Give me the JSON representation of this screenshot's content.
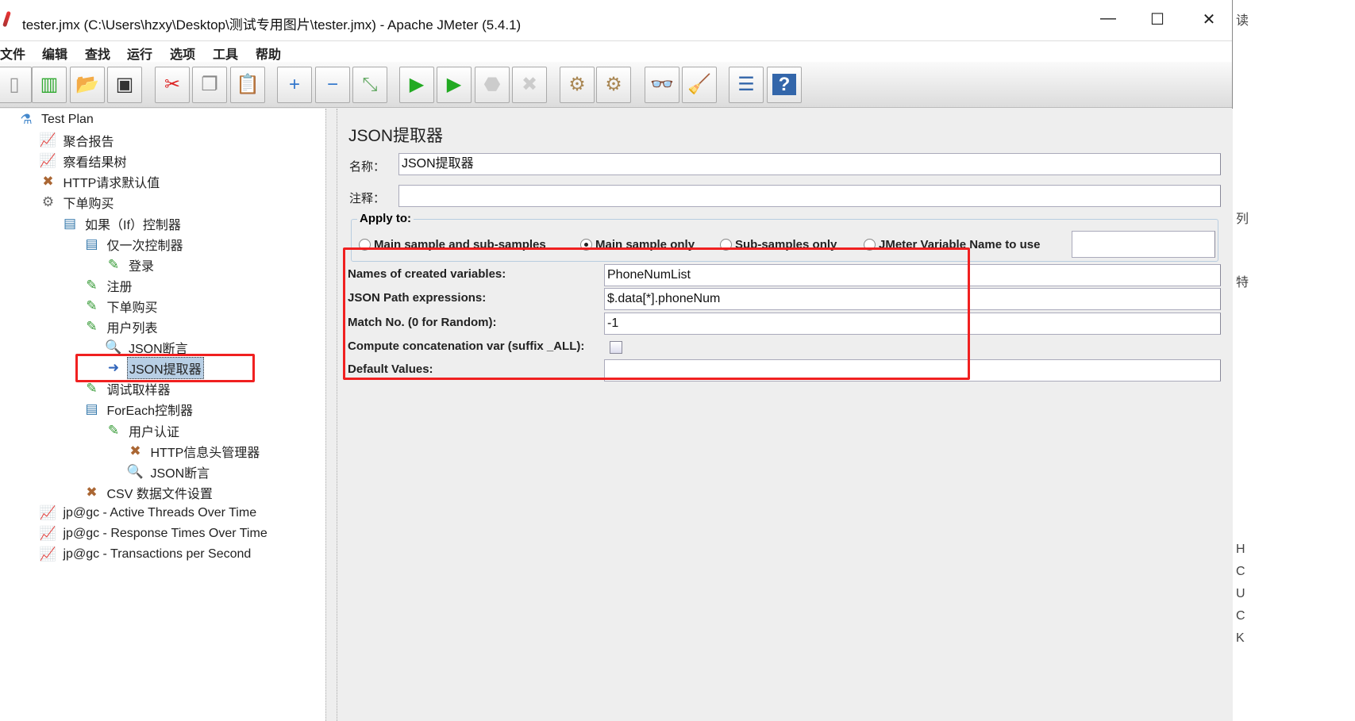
{
  "window": {
    "title": "tester.jmx (C:\\Users\\hzxy\\Desktop\\测试专用图片\\tester.jmx) - Apache JMeter (5.4.1)",
    "minimize": "—",
    "maximize": "☐",
    "close": "✕"
  },
  "menu": [
    "文件",
    "编辑",
    "查找",
    "运行",
    "选项",
    "工具",
    "帮助"
  ],
  "toolbar": [
    {
      "icon": "new-icon",
      "glyph": "▯",
      "color": "#999"
    },
    {
      "icon": "templates-icon",
      "glyph": "▥",
      "color": "#3a3"
    },
    {
      "icon": "open-icon",
      "glyph": "📂",
      "color": "#d90"
    },
    {
      "icon": "save-icon",
      "glyph": "▣",
      "color": "#333"
    },
    {
      "icon": "cut-icon",
      "glyph": "✂",
      "color": "#d22"
    },
    {
      "icon": "copy-icon",
      "glyph": "❐",
      "color": "#888"
    },
    {
      "icon": "paste-icon",
      "glyph": "📋",
      "color": "#a70"
    },
    {
      "icon": "expand-icon",
      "glyph": "+",
      "color": "#37c"
    },
    {
      "icon": "collapse-icon",
      "glyph": "−",
      "color": "#37c"
    },
    {
      "icon": "toggle-icon",
      "glyph": "⤡",
      "color": "#6a6"
    },
    {
      "icon": "start-icon",
      "glyph": "▶",
      "color": "#2a2"
    },
    {
      "icon": "start-no-pauses-icon",
      "glyph": "▶",
      "color": "#2a2"
    },
    {
      "icon": "stop-icon",
      "glyph": "⬣",
      "color": "#ccc"
    },
    {
      "icon": "shutdown-icon",
      "glyph": "✖",
      "color": "#ccc"
    },
    {
      "icon": "clear-icon",
      "glyph": "⚙",
      "color": "#a85"
    },
    {
      "icon": "clear-all-icon",
      "glyph": "⚙",
      "color": "#a85"
    },
    {
      "icon": "search-icon",
      "glyph": "👓",
      "color": "#222"
    },
    {
      "icon": "reset-search-icon",
      "glyph": "🧹",
      "color": "#db0"
    },
    {
      "icon": "function-helper-icon",
      "glyph": "☰",
      "color": "#36a"
    },
    {
      "icon": "help-icon",
      "glyph": "?",
      "color": "#fff"
    }
  ],
  "tree": [
    {
      "label": "Test Plan",
      "level": 0,
      "icon": "test-plan-icon",
      "glyph": "⚗"
    },
    {
      "label": "聚合报告",
      "level": 1,
      "icon": "listener-icon",
      "glyph": "📈"
    },
    {
      "label": "察看结果树",
      "level": 1,
      "icon": "listener-icon",
      "glyph": "📈"
    },
    {
      "label": "HTTP请求默认值",
      "level": 1,
      "icon": "config-icon",
      "glyph": "✖"
    },
    {
      "label": "下单购买",
      "level": 1,
      "icon": "thread-group-icon",
      "glyph": "⚙"
    },
    {
      "label": "如果（If）控制器",
      "level": 2,
      "icon": "controller-icon",
      "glyph": "▤"
    },
    {
      "label": "仅一次控制器",
      "level": 3,
      "icon": "controller-icon",
      "glyph": "▤"
    },
    {
      "label": "登录",
      "level": 4,
      "icon": "sampler-icon",
      "glyph": "✎"
    },
    {
      "label": "注册",
      "level": 3,
      "icon": "sampler-icon",
      "glyph": "✎"
    },
    {
      "label": "下单购买",
      "level": 3,
      "icon": "sampler-icon",
      "glyph": "✎"
    },
    {
      "label": "用户列表",
      "level": 3,
      "icon": "sampler-icon",
      "glyph": "✎"
    },
    {
      "label": "JSON断言",
      "level": 4,
      "icon": "assertion-icon",
      "glyph": "🔍"
    },
    {
      "label": "JSON提取器",
      "level": 4,
      "icon": "extractor-icon",
      "glyph": "➜",
      "selected": true
    },
    {
      "label": "调试取样器",
      "level": 3,
      "icon": "sampler-icon",
      "glyph": "✎"
    },
    {
      "label": "ForEach控制器",
      "level": 3,
      "icon": "controller-icon",
      "glyph": "▤"
    },
    {
      "label": "用户认证",
      "level": 4,
      "icon": "sampler-icon",
      "glyph": "✎"
    },
    {
      "label": "HTTP信息头管理器",
      "level": 5,
      "icon": "config-icon",
      "glyph": "✖"
    },
    {
      "label": "JSON断言",
      "level": 5,
      "icon": "assertion-icon",
      "glyph": "🔍"
    },
    {
      "label": "CSV 数据文件设置",
      "level": 3,
      "icon": "config-icon",
      "glyph": "✖"
    },
    {
      "label": "jp@gc - Active Threads Over Time",
      "level": 1,
      "icon": "listener-icon",
      "glyph": "📈"
    },
    {
      "label": "jp@gc - Response Times Over Time",
      "level": 1,
      "icon": "listener-icon",
      "glyph": "📈"
    },
    {
      "label": "jp@gc - Transactions per Second",
      "level": 1,
      "icon": "listener-icon",
      "glyph": "📈"
    }
  ],
  "panel": {
    "title": "JSON提取器",
    "name_label": "名称：",
    "name_value": "JSON提取器",
    "comment_label": "注释：",
    "comment_value": "",
    "apply_to": "Apply to:",
    "radios": [
      {
        "label": "Main sample and sub-samples",
        "checked": false
      },
      {
        "label": "Main sample only",
        "checked": true
      },
      {
        "label": "Sub-samples only",
        "checked": false
      },
      {
        "label": "JMeter Variable Name to use",
        "checked": false
      }
    ],
    "jmeter_var_value": "",
    "fields": [
      {
        "label": "Names of created variables:",
        "value": "PhoneNumList"
      },
      {
        "label": "JSON Path expressions:",
        "value": "$.data[*].phoneNum"
      },
      {
        "label": "Match No. (0 for Random):",
        "value": "-1"
      }
    ],
    "concat_label": "Compute concatenation var (suffix _ALL):",
    "concat_checked": false,
    "default_label": "Default Values:",
    "default_value": ""
  },
  "highlight_color": "#f02020",
  "background_fragments": [
    "读",
    "列",
    "特",
    "H",
    "C",
    "U",
    "C",
    "K"
  ]
}
